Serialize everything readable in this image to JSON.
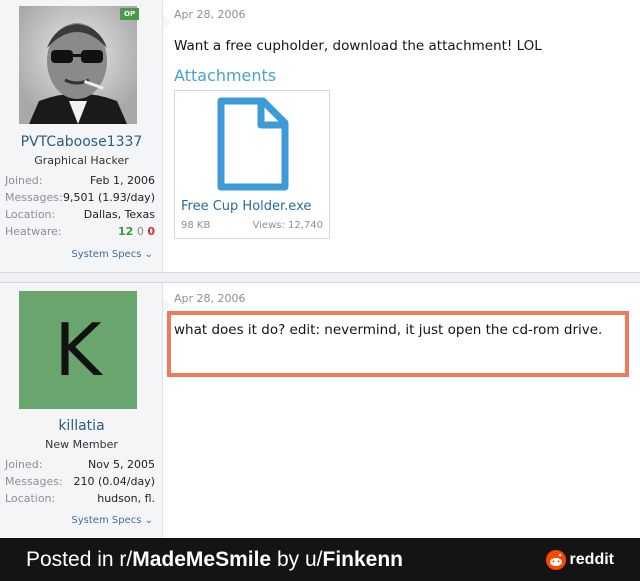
{
  "posts": [
    {
      "op_badge": "OP",
      "username": "PVTCaboose1337",
      "user_title": "Graphical Hacker",
      "stats": {
        "joined_label": "Joined:",
        "joined": "Feb 1, 2006",
        "messages_label": "Messages:",
        "messages": "9,501 (1.93/day)",
        "location_label": "Location:",
        "location": "Dallas, Texas",
        "heatware_label": "Heatware:",
        "heatware_pos": "12",
        "heatware_neu": "0",
        "heatware_neg": "0"
      },
      "system_specs": "System Specs",
      "date": "Apr 28, 2006",
      "message": "Want a free cupholder, download the attachment! LOL",
      "attachments_title": "Attachments",
      "attachment": {
        "name": "Free Cup Holder.exe",
        "size": "98 KB",
        "views": "Views: 12,740"
      }
    },
    {
      "avatar_letter": "K",
      "username": "killatia",
      "user_title": "New Member",
      "stats": {
        "joined_label": "Joined:",
        "joined": "Nov 5, 2005",
        "messages_label": "Messages:",
        "messages": "210 (0.04/day)",
        "location_label": "Location:",
        "location": "hudson, fl."
      },
      "system_specs": "System Specs",
      "date": "Apr 28, 2006",
      "message": "what does it do? edit: nevermind, it just open the cd-rom drive."
    }
  ],
  "footer": {
    "prefix": "Posted in r/",
    "subreddit": "MadeMeSmile",
    "by": " by u/",
    "user": "Finkenn",
    "brand": "reddit"
  },
  "colors": {
    "accent": "#4aa2cf",
    "highlight": "#ef7a5c",
    "avatar_green": "#6aa56e",
    "footer_bg": "#141414"
  }
}
